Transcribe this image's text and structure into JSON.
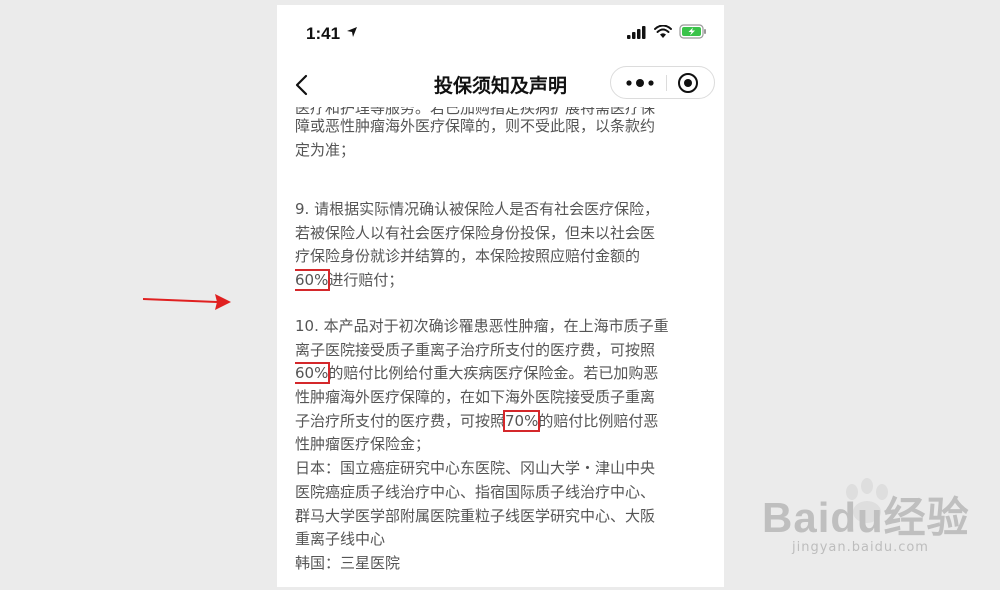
{
  "status_bar": {
    "time": "1:41"
  },
  "nav": {
    "title": "投保须知及声明"
  },
  "content": {
    "partial_line": "医疗和护理等服务。若已加购指定疾病扩展特需医疗保",
    "para_prev": [
      "障或恶性肿瘤海外医疗保障的，则不受此限，以条款约",
      "定为准；"
    ],
    "para9": [
      "9. 请根据实际情况确认被保险人是否有社会医疗保险，",
      "若被保险人以有社会医疗保险身份投保，但未以社会医",
      "疗保险身份就诊并结算的，本保险按照应赔付金额的"
    ],
    "para9_last": {
      "highlight": "60%",
      "rest": "进行赔付；"
    },
    "para10_line1": "10. 本产品对于初次确诊罹患恶性肿瘤，在上海市质子重",
    "para10_line2": "离子医院接受质子重离子治疗所支付的医疗费，可按照",
    "para10_line3": {
      "highlight": "60%",
      "rest": "的赔付比例给付重大疾病医疗保险金。若已加购恶"
    },
    "para10_line4": "性肿瘤海外医疗保障的，在如下海外医院接受质子重离",
    "para10_line5": {
      "before": "子治疗所支付的医疗费，可按照",
      "highlight": "70%",
      "rest": "的赔付比例赔付恶"
    },
    "para10_rest": [
      "性肿瘤医疗保险金；",
      "日本：国立癌症研究中心东医院、冈山大学・津山中央",
      "医院癌症质子线治疗中心、指宿国际质子线治疗中心、",
      "群马大学医学部附属医院重粒子线医学研究中心、大阪",
      "重离子线中心",
      "韩国：三星医院"
    ]
  },
  "watermark": {
    "brand": "Baidu经验",
    "url": "jingyan.baidu.com"
  },
  "colors": {
    "highlight": "#d4282b",
    "text": "#555555",
    "background": "#ebebeb"
  }
}
